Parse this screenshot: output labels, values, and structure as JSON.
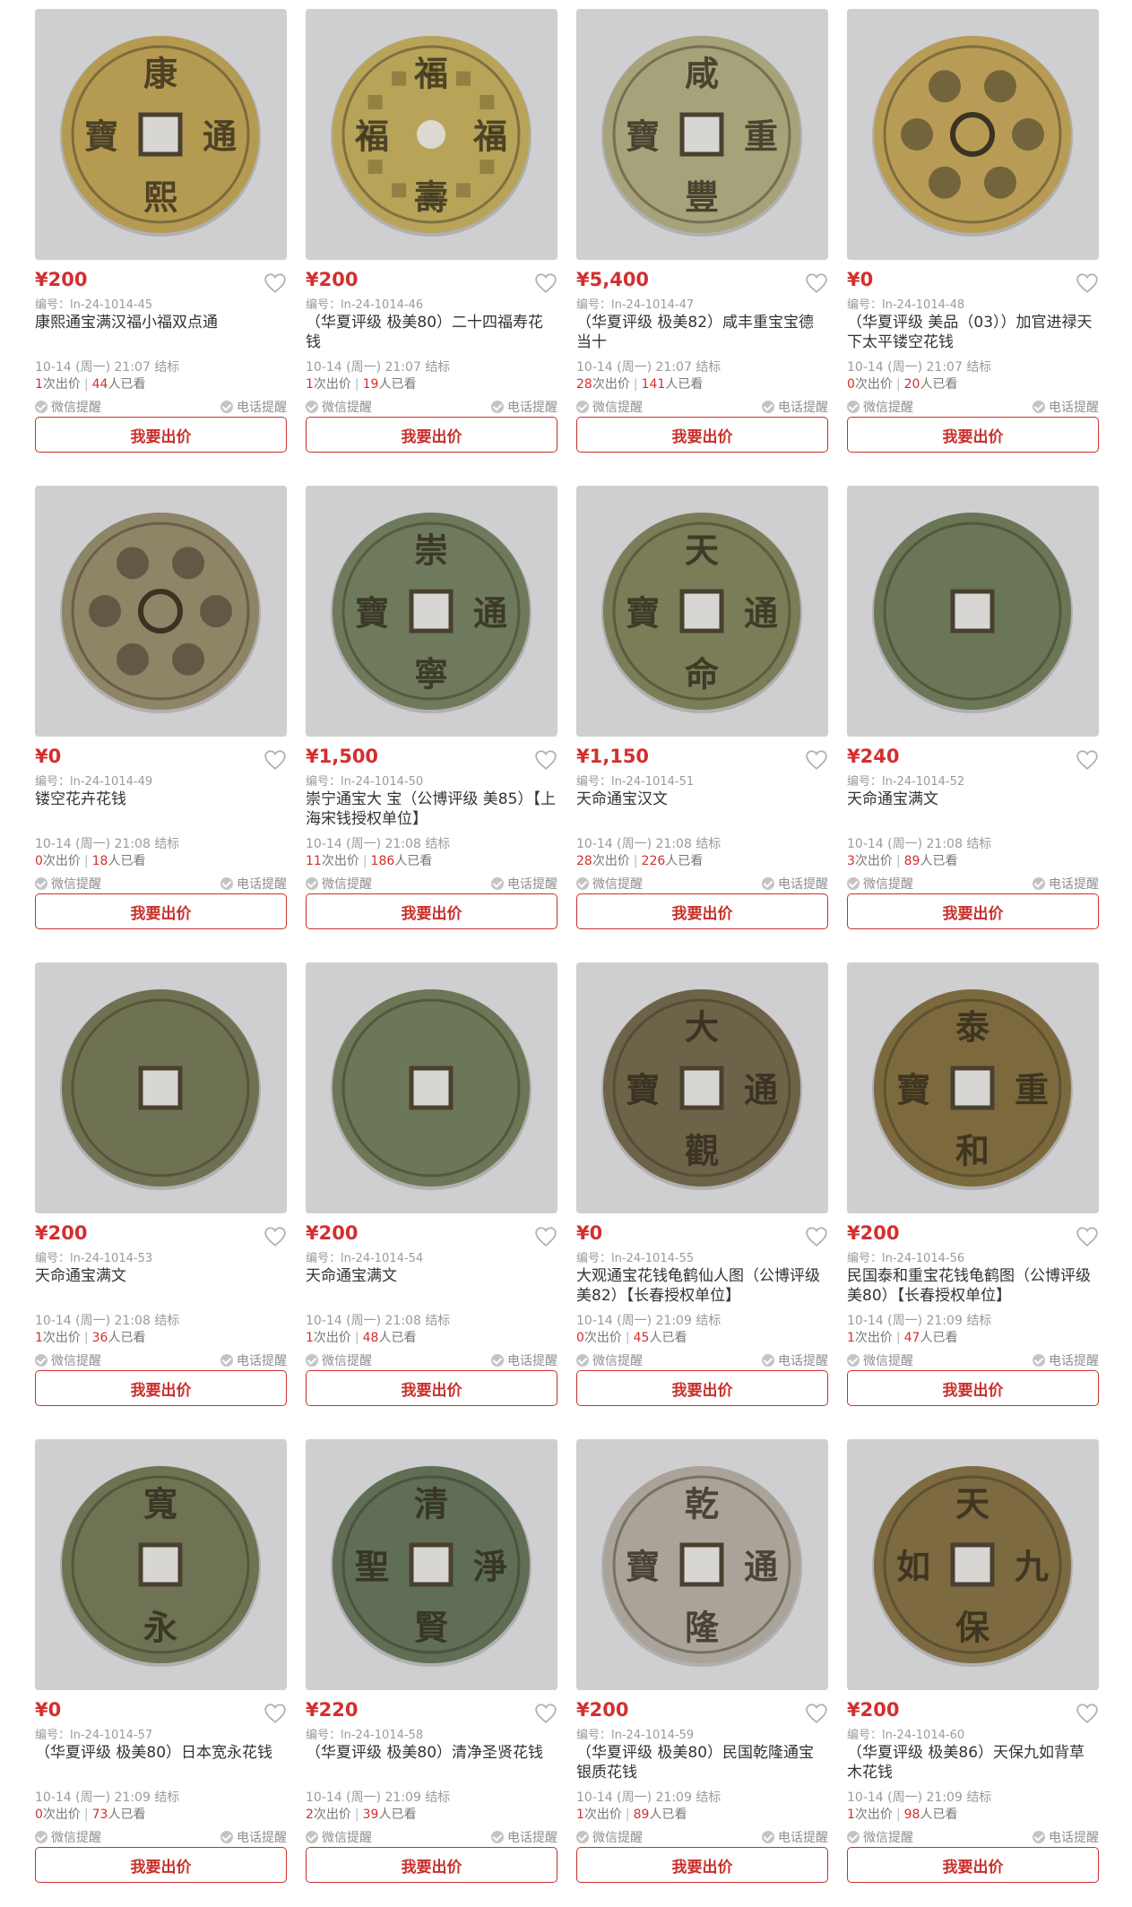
{
  "ui": {
    "bid_label": "我要出价",
    "wechat_label": "微信提醒",
    "phone_label": "电话提醒",
    "code_prefix": "编号：",
    "end_suffix": "结标",
    "bids_suffix": "次出价",
    "views_suffix": "人已看",
    "favorite_icon": "heart-outline-icon",
    "check_icon": "check-circle-icon",
    "colors": {
      "price": "#d32f2f",
      "button_border": "#c9302c",
      "muted": "#9a9a9a",
      "thumb_bg": "#cfcfd1"
    }
  },
  "items": [
    {
      "price": "¥200",
      "code": "ln-24-1014-45",
      "title": "康熙通宝满汉福小福双点通",
      "end_time": "10-14 (周一) 21:07",
      "bids": "1",
      "views": "44",
      "coin": [
        "康",
        "熙",
        "通",
        "寶"
      ],
      "metal": "#b59a52",
      "pattern": "square"
    },
    {
      "price": "¥200",
      "code": "ln-24-1014-46",
      "title": "（华夏评级 极美80）二十四福寿花钱",
      "end_time": "10-14 (周一) 21:07",
      "bids": "1",
      "views": "19",
      "coin": [
        "福",
        "壽",
        "福",
        "福"
      ],
      "metal": "#b8a458",
      "pattern": "round"
    },
    {
      "price": "¥5,400",
      "code": "ln-24-1014-47",
      "title": "（华夏评级 极美82）咸丰重宝宝德当十",
      "end_time": "10-14 (周一) 21:07",
      "bids": "28",
      "views": "141",
      "coin": [
        "咸",
        "豐",
        "重",
        "寶"
      ],
      "metal": "#a6a27a",
      "pattern": "square"
    },
    {
      "price": "¥0",
      "code": "ln-24-1014-48",
      "title": "（华夏评级 美品（03））加官进禄天下太平镂空花钱",
      "end_time": "10-14 (周一) 21:07",
      "bids": "0",
      "views": "20",
      "coin": [
        "",
        "",
        "",
        ""
      ],
      "metal": "#b89c55",
      "pattern": "openwork"
    },
    {
      "price": "¥0",
      "code": "ln-24-1014-49",
      "title": "镂空花卉花钱",
      "end_time": "10-14 (周一) 21:08",
      "bids": "0",
      "views": "18",
      "coin": [
        "",
        "",
        "",
        ""
      ],
      "metal": "#8e8466",
      "pattern": "openwork"
    },
    {
      "price": "¥1,500",
      "code": "ln-24-1014-50",
      "title": "崇宁通宝大 宝（公博评级 美85）【上海宋钱授权单位】",
      "end_time": "10-14 (周一) 21:08",
      "bids": "11",
      "views": "186",
      "coin": [
        "崇",
        "寧",
        "通",
        "寶"
      ],
      "metal": "#6f7a5c",
      "pattern": "square"
    },
    {
      "price": "¥1,150",
      "code": "ln-24-1014-51",
      "title": "天命通宝汉文",
      "end_time": "10-14 (周一) 21:08",
      "bids": "28",
      "views": "226",
      "coin": [
        "天",
        "命",
        "通",
        "寶"
      ],
      "metal": "#7a7d58",
      "pattern": "square"
    },
    {
      "price": "¥240",
      "code": "ln-24-1014-52",
      "title": "天命通宝满文",
      "end_time": "10-14 (周一) 21:08",
      "bids": "3",
      "views": "89",
      "coin": [
        "",
        "",
        "",
        ""
      ],
      "metal": "#6a7656",
      "pattern": "square"
    },
    {
      "price": "¥200",
      "code": "ln-24-1014-53",
      "title": "天命通宝满文",
      "end_time": "10-14 (周一) 21:08",
      "bids": "1",
      "views": "36",
      "coin": [
        "",
        "",
        "",
        ""
      ],
      "metal": "#6f7252",
      "pattern": "square"
    },
    {
      "price": "¥200",
      "code": "ln-24-1014-54",
      "title": "天命通宝满文",
      "end_time": "10-14 (周一) 21:08",
      "bids": "1",
      "views": "48",
      "coin": [
        "",
        "",
        "",
        ""
      ],
      "metal": "#6b7756",
      "pattern": "square"
    },
    {
      "price": "¥0",
      "code": "ln-24-1014-55",
      "title": "大观通宝花钱龟鹤仙人图（公博评级 美82）【长春授权单位】",
      "end_time": "10-14 (周一) 21:09",
      "bids": "0",
      "views": "45",
      "coin": [
        "大",
        "觀",
        "通",
        "寶"
      ],
      "metal": "#6c6348",
      "pattern": "square"
    },
    {
      "price": "¥200",
      "code": "ln-24-1014-56",
      "title": "民国泰和重宝花钱龟鹤图（公博评级 美80）【长春授权单位】",
      "end_time": "10-14 (周一) 21:09",
      "bids": "1",
      "views": "47",
      "coin": [
        "泰",
        "和",
        "重",
        "寶"
      ],
      "metal": "#7c6a3e",
      "pattern": "square"
    },
    {
      "price": "¥0",
      "code": "ln-24-1014-57",
      "title": "（华夏评级 极美80）日本宽永花钱",
      "end_time": "10-14 (周一) 21:09",
      "bids": "0",
      "views": "73",
      "coin": [
        "寬",
        "永",
        "",
        ""
      ],
      "metal": "#6e7453",
      "pattern": "square"
    },
    {
      "price": "¥220",
      "code": "ln-24-1014-58",
      "title": "（华夏评级 极美80）清净圣贤花钱",
      "end_time": "10-14 (周一) 21:09",
      "bids": "2",
      "views": "39",
      "coin": [
        "清",
        "賢",
        "淨",
        "聖"
      ],
      "metal": "#5f6e54",
      "pattern": "square"
    },
    {
      "price": "¥200",
      "code": "ln-24-1014-59",
      "title": "（华夏评级 极美80）民国乾隆通宝银质花钱",
      "end_time": "10-14 (周一) 21:09",
      "bids": "1",
      "views": "89",
      "coin": [
        "乾",
        "隆",
        "通",
        "寶"
      ],
      "metal": "#a9a39a",
      "pattern": "square"
    },
    {
      "price": "¥200",
      "code": "ln-24-1014-60",
      "title": "（华夏评级 极美86）天保九如背草木花钱",
      "end_time": "10-14 (周一) 21:09",
      "bids": "1",
      "views": "98",
      "coin": [
        "天",
        "保",
        "九",
        "如"
      ],
      "metal": "#7d6a40",
      "pattern": "square"
    }
  ]
}
